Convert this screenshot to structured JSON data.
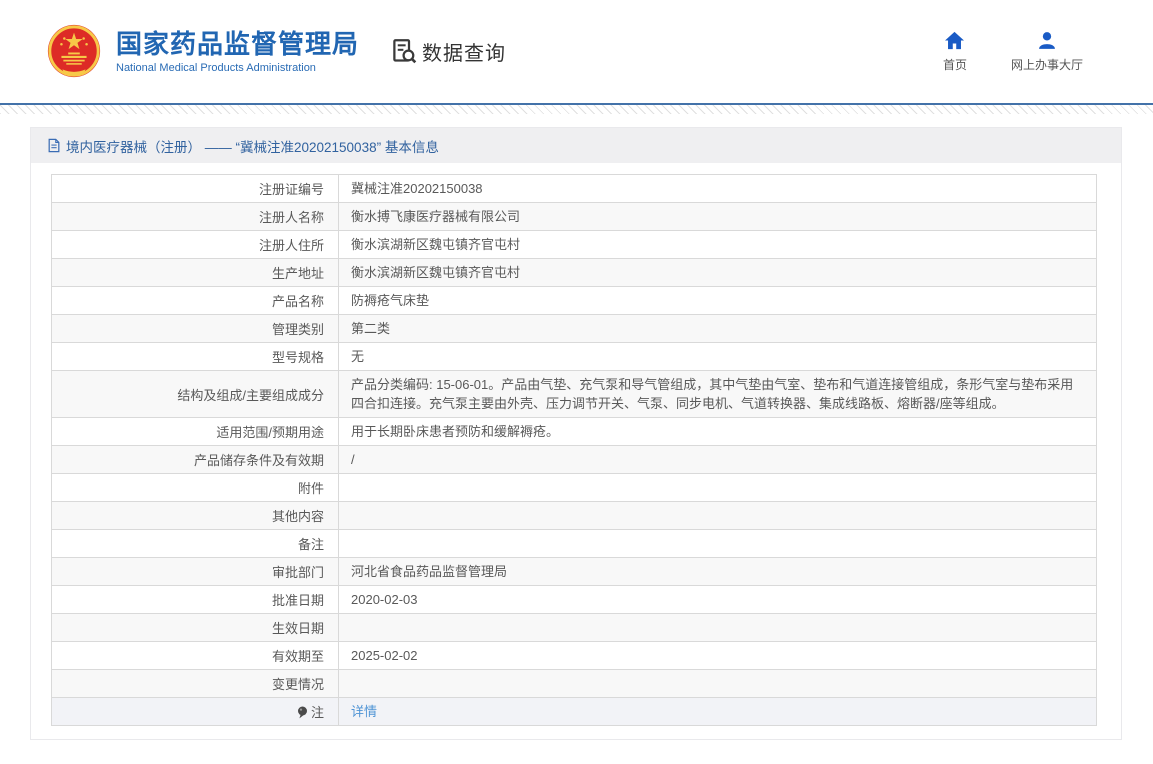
{
  "header": {
    "brand": {
      "title": "国家药品监督管理局",
      "subtitle": "National Medical Products Administration"
    },
    "section": {
      "label": "数据查询"
    },
    "nav": {
      "home": "首页",
      "hall": "网上办事大厅"
    }
  },
  "panel": {
    "title": "境内医疗器械（注册） —— “冀械注准20202150038” 基本信息",
    "rows": [
      {
        "label": "注册证编号",
        "value": "冀械注准20202150038"
      },
      {
        "label": "注册人名称",
        "value": "衡水搏飞康医疗器械有限公司"
      },
      {
        "label": "注册人住所",
        "value": "衡水滨湖新区魏屯镇齐官屯村"
      },
      {
        "label": "生产地址",
        "value": "衡水滨湖新区魏屯镇齐官屯村"
      },
      {
        "label": "产品名称",
        "value": "防褥疮气床垫"
      },
      {
        "label": "管理类别",
        "value": "第二类"
      },
      {
        "label": "型号规格",
        "value": "无"
      },
      {
        "label": "结构及组成/主要组成成分",
        "value": "产品分类编码: 15-06-01。产品由气垫、充气泵和导气管组成，其中气垫由气室、垫布和气道连接管组成，条形气室与垫布采用四合扣连接。充气泵主要由外壳、压力调节开关、气泵、同步电机、气道转换器、集成线路板、熔断器/座等组成。"
      },
      {
        "label": "适用范围/预期用途",
        "value": "用于长期卧床患者预防和缓解褥疮。"
      },
      {
        "label": "产品储存条件及有效期",
        "value": "/"
      },
      {
        "label": "附件",
        "value": ""
      },
      {
        "label": "其他内容",
        "value": ""
      },
      {
        "label": "备注",
        "value": ""
      },
      {
        "label": "审批部门",
        "value": "河北省食品药品监督管理局"
      },
      {
        "label": "批准日期",
        "value": "2020-02-03"
      },
      {
        "label": "生效日期",
        "value": ""
      },
      {
        "label": "有效期至",
        "value": "2025-02-02"
      },
      {
        "label": "变更情况",
        "value": ""
      }
    ],
    "note_row": {
      "label": "注",
      "link": "详情"
    }
  },
  "colors": {
    "brand_blue": "#2166b2",
    "icon_blue": "#1a5bc5",
    "link_blue": "#4f94d5",
    "emblem_red": "#dd2b26",
    "emblem_gold": "#f7c948",
    "panel_title_bg": "#efeff1",
    "row_alt_bg": "#f8f8f8",
    "note_row_bg": "#f2f3f7"
  }
}
